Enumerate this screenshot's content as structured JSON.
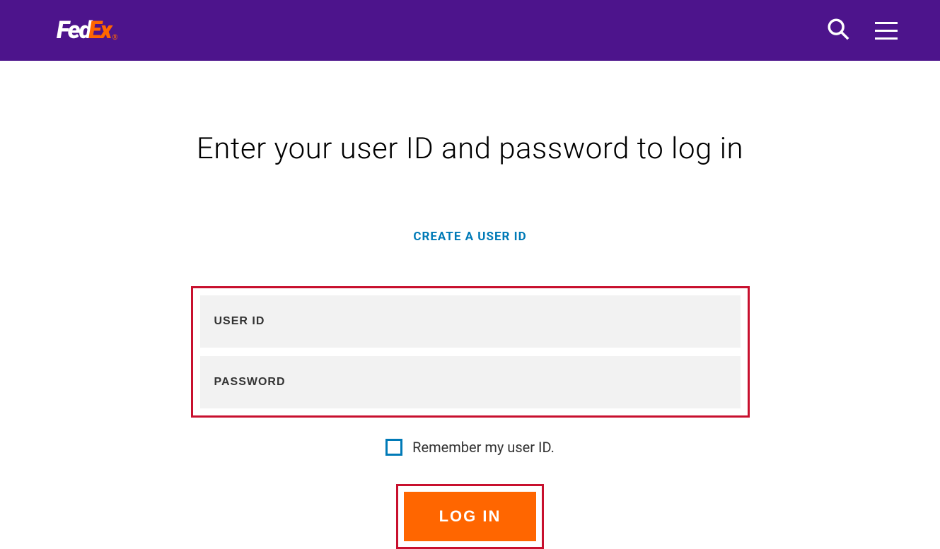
{
  "header": {
    "logo_fed": "Fed",
    "logo_ex": "Ex",
    "logo_reg": "®"
  },
  "main": {
    "title": "Enter your user ID and password to log in",
    "create_link": "CREATE A USER ID",
    "form": {
      "user_id_placeholder": "USER ID",
      "password_placeholder": "PASSWORD"
    },
    "remember_label": "Remember my user ID.",
    "login_button": "LOG IN"
  }
}
